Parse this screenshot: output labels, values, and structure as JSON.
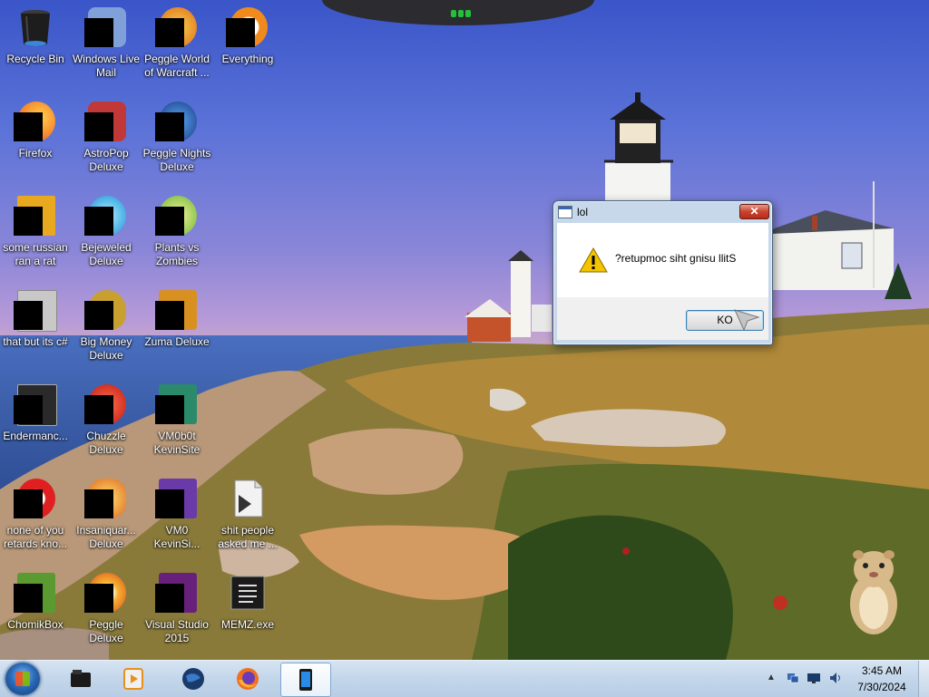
{
  "desktop": {
    "icons": [
      {
        "label": "Recycle Bin",
        "icon": "recycle-bin-icon",
        "color": "#2b2b2b"
      },
      {
        "label": "Windows Live Mail",
        "icon": "windows-live-mail-icon",
        "color": "#6e8fc8"
      },
      {
        "label": "Peggle World of Warcraft ...",
        "icon": "peggle-wow-icon",
        "color": "#e8a020"
      },
      {
        "label": "Everything",
        "icon": "everything-search-icon",
        "color": "#f08a1c"
      },
      {
        "label": "Firefox",
        "icon": "firefox-icon",
        "color": "#f07020"
      },
      {
        "label": "AstroPop Deluxe",
        "icon": "astropop-icon",
        "color": "#c03030"
      },
      {
        "label": "Peggle Nights Deluxe",
        "icon": "peggle-nights-icon",
        "color": "#3a78c8"
      },
      {
        "label": "some russian ran a rat",
        "icon": "rat-app-icon",
        "color": "#e8a820"
      },
      {
        "label": "Bejeweled Deluxe",
        "icon": "bejeweled-icon",
        "color": "#2aa8e8"
      },
      {
        "label": "Plants vs Zombies",
        "icon": "plants-vs-zombies-icon",
        "color": "#6ab830"
      },
      {
        "label": "that but its c#",
        "icon": "file-stack-icon",
        "color": "#b8b8b8"
      },
      {
        "label": "Big Money Deluxe",
        "icon": "big-money-icon",
        "color": "#c8a030"
      },
      {
        "label": "Zuma Deluxe",
        "icon": "zuma-icon",
        "color": "#d89020"
      },
      {
        "label": "Endermanc...",
        "icon": "terminal-app-icon",
        "color": "#303030"
      },
      {
        "label": "Chuzzle Deluxe",
        "icon": "chuzzle-icon",
        "color": "#e03020"
      },
      {
        "label": "VM0b0t KevinSite",
        "icon": "vm-app-icon",
        "color": "#2a8a6a"
      },
      {
        "label": "none of you retards kno...",
        "icon": "opera-like-icon",
        "color": "#e02020"
      },
      {
        "label": "Insaniquar... Deluxe",
        "icon": "insaniquarium-icon",
        "color": "#e06a20"
      },
      {
        "label": "VM0 KevinSi...",
        "icon": "vm-app-icon-2",
        "color": "#6a3aa8"
      },
      {
        "label": "shit people asked me ...",
        "icon": "text-document-icon",
        "color": "#e8e8e8"
      },
      {
        "label": "ChomikBox",
        "icon": "chomikbox-icon",
        "color": "#5a9a30"
      },
      {
        "label": "Peggle Deluxe",
        "icon": "peggle-deluxe-icon",
        "color": "#e8a020"
      },
      {
        "label": "Visual Studio 2015",
        "icon": "visual-studio-icon",
        "color": "#68217a"
      },
      {
        "label": "MEMZ.exe",
        "icon": "memz-exe-icon",
        "color": "#303030"
      }
    ]
  },
  "dialog": {
    "title": "lol",
    "close_label": "✕",
    "message": "?retupmoc siht gnisu llitS",
    "ok_label": "KO",
    "warning_icon": "warning-triangle-icon"
  },
  "taskbar": {
    "items": [
      {
        "name": "taskbar-explorer",
        "icon": "folder-icon"
      },
      {
        "name": "taskbar-media-player",
        "icon": "media-player-icon"
      },
      {
        "name": "taskbar-globe",
        "icon": "globe-icon"
      },
      {
        "name": "taskbar-firefox",
        "icon": "firefox-icon"
      },
      {
        "name": "taskbar-tablet-app",
        "icon": "tablet-icon"
      }
    ],
    "tray": {
      "expand": "▲",
      "time": "3:45 AM",
      "date": "7/30/2024"
    }
  },
  "colors": {
    "taskbar": "#c3d6ea",
    "dialog_frame": "#c7d8ea",
    "close_button": "#c8442e",
    "ok_border": "#3c7fb1"
  }
}
